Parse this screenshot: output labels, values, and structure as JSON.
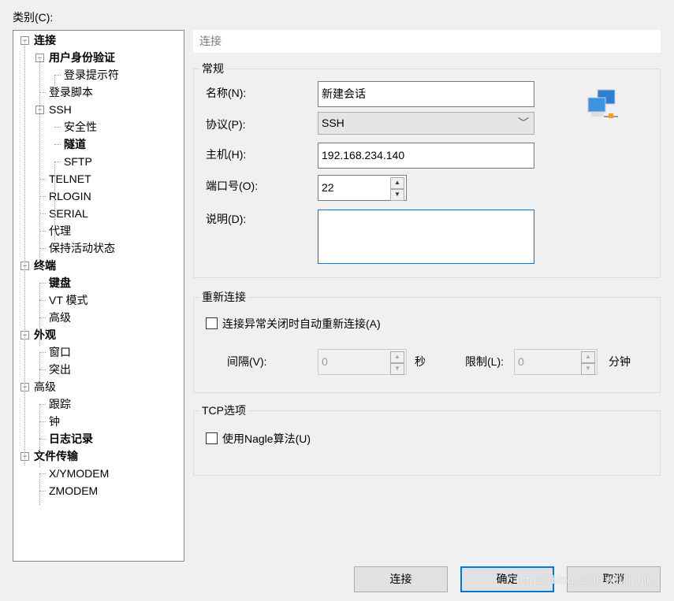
{
  "category_label": "类别(C):",
  "tree": [
    {
      "label": "连接",
      "level": 0,
      "bold": true,
      "toggle": "⊟"
    },
    {
      "label": "用户身份验证",
      "level": 1,
      "bold": true,
      "toggle": "⊟"
    },
    {
      "label": "登录提示符",
      "level": 2
    },
    {
      "label": "登录脚本",
      "level": 1
    },
    {
      "label": "SSH",
      "level": 1,
      "toggle": "⊟"
    },
    {
      "label": "安全性",
      "level": 2
    },
    {
      "label": "隧道",
      "level": 2,
      "bold": true
    },
    {
      "label": "SFTP",
      "level": 2
    },
    {
      "label": "TELNET",
      "level": 1
    },
    {
      "label": "RLOGIN",
      "level": 1
    },
    {
      "label": "SERIAL",
      "level": 1
    },
    {
      "label": "代理",
      "level": 1
    },
    {
      "label": "保持活动状态",
      "level": 1
    },
    {
      "label": "终端",
      "level": 0,
      "bold": true,
      "toggle": "⊟"
    },
    {
      "label": "键盘",
      "level": 1,
      "bold": true
    },
    {
      "label": "VT 模式",
      "level": 1
    },
    {
      "label": "高级",
      "level": 1
    },
    {
      "label": "外观",
      "level": 0,
      "bold": true,
      "toggle": "⊟"
    },
    {
      "label": "窗口",
      "level": 1
    },
    {
      "label": "突出",
      "level": 1
    },
    {
      "label": "高级",
      "level": 0,
      "toggle": "⊟"
    },
    {
      "label": "跟踪",
      "level": 1
    },
    {
      "label": "钟",
      "level": 1
    },
    {
      "label": "日志记录",
      "level": 1,
      "bold": true
    },
    {
      "label": "文件传输",
      "level": 0,
      "bold": true,
      "toggle": "⊟"
    },
    {
      "label": "X/YMODEM",
      "level": 1
    },
    {
      "label": "ZMODEM",
      "level": 1
    }
  ],
  "section_header": "连接",
  "general": {
    "title": "常规",
    "name_label": "名称(N):",
    "name_value": "新建会话",
    "protocol_label": "协议(P):",
    "protocol_value": "SSH",
    "host_label": "主机(H):",
    "host_value": "192.168.234.140",
    "port_label": "端口号(O):",
    "port_value": "22",
    "desc_label": "说明(D):",
    "desc_value": ""
  },
  "reconnect": {
    "title": "重新连接",
    "checkbox_label": "连接异常关闭时自动重新连接(A)",
    "interval_label": "间隔(V):",
    "interval_value": "0",
    "interval_unit": "秒",
    "limit_label": "限制(L):",
    "limit_value": "0",
    "limit_unit": "分钟"
  },
  "tcp": {
    "title": "TCP选项",
    "nagle_label": "使用Nagle算法(U)"
  },
  "buttons": {
    "connect": "连接",
    "ok": "确定",
    "cancel": "取消"
  },
  "watermark": "https://blog.csdn.net/liubing"
}
